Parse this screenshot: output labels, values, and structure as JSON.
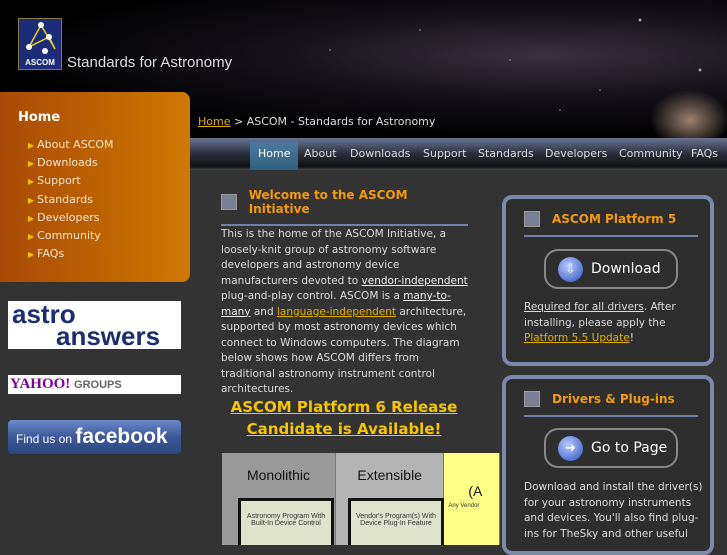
{
  "header": {
    "logo_text": "ASCOM",
    "site_title": "Standards for Astronomy"
  },
  "breadcrumb": {
    "home": "Home",
    "separator": ">",
    "current": "ASCOM - Standards for Astronomy"
  },
  "nav": [
    {
      "label": "Home",
      "active": true
    },
    {
      "label": "About"
    },
    {
      "label": "Downloads"
    },
    {
      "label": "Support"
    },
    {
      "label": "Standards"
    },
    {
      "label": "Developers"
    },
    {
      "label": "Community"
    },
    {
      "label": "FAQs"
    }
  ],
  "sidebar": {
    "title": "Home",
    "items": [
      "About ASCOM",
      "Downloads",
      "Support",
      "Standards",
      "Developers",
      "Community",
      "FAQs"
    ]
  },
  "banners": {
    "astro_line1": "astro",
    "astro_line2": "answers",
    "yahoo": "YAHOO!",
    "yahoo_groups": "GROUPS",
    "fb_prefix": "Find us on",
    "fb_brand": "facebook"
  },
  "welcome": {
    "title": "Welcome to the ASCOM Initiative",
    "p1": "This is the home of the ASCOM Initiative, a loosely-knit group of astronomy software developers and astronomy device manufacturers devoted to ",
    "link1": "vendor-independent",
    "p2": " plug-and-play control. ASCOM is a ",
    "link2": "many-to-many",
    "p3": " and ",
    "link3": "language-independent",
    "p4": " architecture, supported by most astronomy devices which connect to Windows computers. The diagram below shows how ASCOM differs from traditional astronomy instrument control architectures.",
    "announcement": "ASCOM Platform 6 Release Candidate is Available!"
  },
  "diagram": {
    "panels": [
      {
        "title": "Monolithic",
        "box": "Astronomy Program With Built-In Device Control"
      },
      {
        "title": "Extensible",
        "box": "Vendor's Program(s) With Device Plug-In Feature"
      },
      {
        "title": "(A",
        "box": "Any Vendor"
      }
    ]
  },
  "platform5": {
    "title": "ASCOM Platform 5",
    "button": "Download",
    "link1": "Required for all drivers",
    "t1": ". After installing, please apply the ",
    "link2": "Platform 5.5 Update",
    "t2": "!"
  },
  "drivers": {
    "title": "Drivers & Plug-ins",
    "button": "Go to Page",
    "text": "Download and install the driver(s) for your astronomy instruments and devices. You'll also find plug-ins for TheSky and other useful"
  },
  "colors": {
    "accent": "#f39a0d",
    "link": "#e0b000",
    "box_border": "#7b8aaa"
  }
}
